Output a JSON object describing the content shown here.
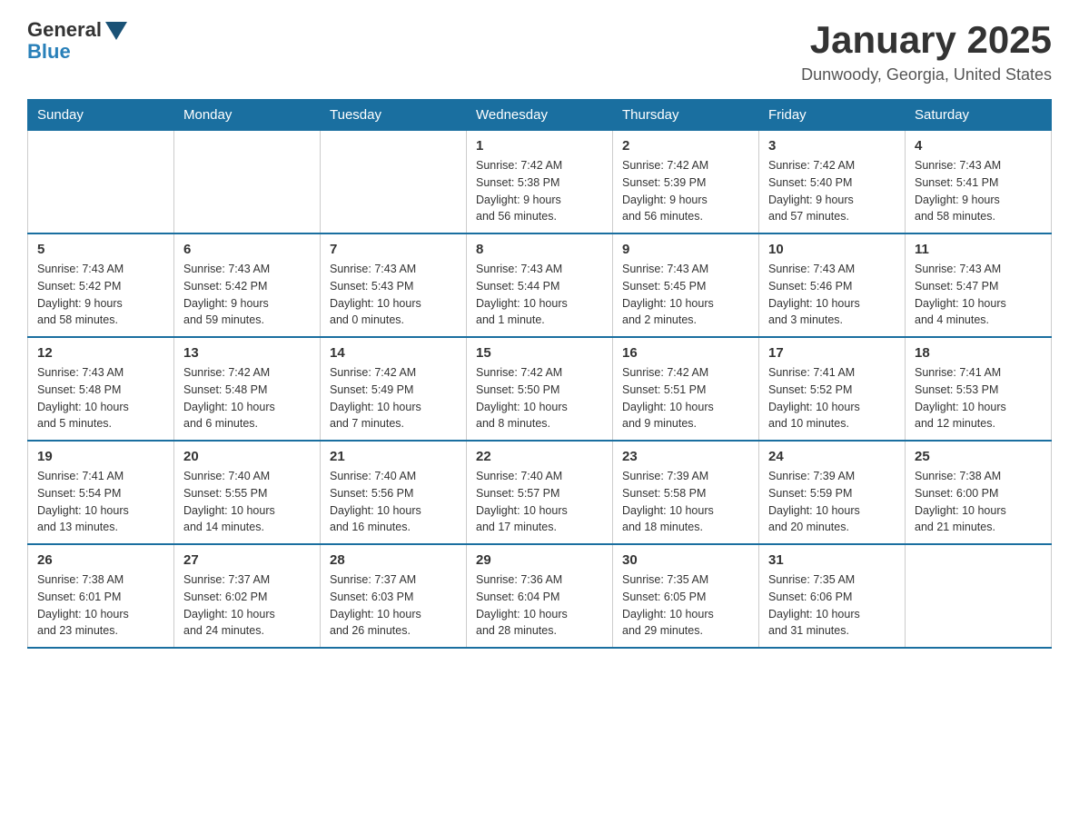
{
  "logo": {
    "general": "General",
    "blue": "Blue"
  },
  "header": {
    "title": "January 2025",
    "location": "Dunwoody, Georgia, United States"
  },
  "days_of_week": [
    "Sunday",
    "Monday",
    "Tuesday",
    "Wednesday",
    "Thursday",
    "Friday",
    "Saturday"
  ],
  "weeks": [
    [
      {
        "day": "",
        "info": ""
      },
      {
        "day": "",
        "info": ""
      },
      {
        "day": "",
        "info": ""
      },
      {
        "day": "1",
        "info": "Sunrise: 7:42 AM\nSunset: 5:38 PM\nDaylight: 9 hours\nand 56 minutes."
      },
      {
        "day": "2",
        "info": "Sunrise: 7:42 AM\nSunset: 5:39 PM\nDaylight: 9 hours\nand 56 minutes."
      },
      {
        "day": "3",
        "info": "Sunrise: 7:42 AM\nSunset: 5:40 PM\nDaylight: 9 hours\nand 57 minutes."
      },
      {
        "day": "4",
        "info": "Sunrise: 7:43 AM\nSunset: 5:41 PM\nDaylight: 9 hours\nand 58 minutes."
      }
    ],
    [
      {
        "day": "5",
        "info": "Sunrise: 7:43 AM\nSunset: 5:42 PM\nDaylight: 9 hours\nand 58 minutes."
      },
      {
        "day": "6",
        "info": "Sunrise: 7:43 AM\nSunset: 5:42 PM\nDaylight: 9 hours\nand 59 minutes."
      },
      {
        "day": "7",
        "info": "Sunrise: 7:43 AM\nSunset: 5:43 PM\nDaylight: 10 hours\nand 0 minutes."
      },
      {
        "day": "8",
        "info": "Sunrise: 7:43 AM\nSunset: 5:44 PM\nDaylight: 10 hours\nand 1 minute."
      },
      {
        "day": "9",
        "info": "Sunrise: 7:43 AM\nSunset: 5:45 PM\nDaylight: 10 hours\nand 2 minutes."
      },
      {
        "day": "10",
        "info": "Sunrise: 7:43 AM\nSunset: 5:46 PM\nDaylight: 10 hours\nand 3 minutes."
      },
      {
        "day": "11",
        "info": "Sunrise: 7:43 AM\nSunset: 5:47 PM\nDaylight: 10 hours\nand 4 minutes."
      }
    ],
    [
      {
        "day": "12",
        "info": "Sunrise: 7:43 AM\nSunset: 5:48 PM\nDaylight: 10 hours\nand 5 minutes."
      },
      {
        "day": "13",
        "info": "Sunrise: 7:42 AM\nSunset: 5:48 PM\nDaylight: 10 hours\nand 6 minutes."
      },
      {
        "day": "14",
        "info": "Sunrise: 7:42 AM\nSunset: 5:49 PM\nDaylight: 10 hours\nand 7 minutes."
      },
      {
        "day": "15",
        "info": "Sunrise: 7:42 AM\nSunset: 5:50 PM\nDaylight: 10 hours\nand 8 minutes."
      },
      {
        "day": "16",
        "info": "Sunrise: 7:42 AM\nSunset: 5:51 PM\nDaylight: 10 hours\nand 9 minutes."
      },
      {
        "day": "17",
        "info": "Sunrise: 7:41 AM\nSunset: 5:52 PM\nDaylight: 10 hours\nand 10 minutes."
      },
      {
        "day": "18",
        "info": "Sunrise: 7:41 AM\nSunset: 5:53 PM\nDaylight: 10 hours\nand 12 minutes."
      }
    ],
    [
      {
        "day": "19",
        "info": "Sunrise: 7:41 AM\nSunset: 5:54 PM\nDaylight: 10 hours\nand 13 minutes."
      },
      {
        "day": "20",
        "info": "Sunrise: 7:40 AM\nSunset: 5:55 PM\nDaylight: 10 hours\nand 14 minutes."
      },
      {
        "day": "21",
        "info": "Sunrise: 7:40 AM\nSunset: 5:56 PM\nDaylight: 10 hours\nand 16 minutes."
      },
      {
        "day": "22",
        "info": "Sunrise: 7:40 AM\nSunset: 5:57 PM\nDaylight: 10 hours\nand 17 minutes."
      },
      {
        "day": "23",
        "info": "Sunrise: 7:39 AM\nSunset: 5:58 PM\nDaylight: 10 hours\nand 18 minutes."
      },
      {
        "day": "24",
        "info": "Sunrise: 7:39 AM\nSunset: 5:59 PM\nDaylight: 10 hours\nand 20 minutes."
      },
      {
        "day": "25",
        "info": "Sunrise: 7:38 AM\nSunset: 6:00 PM\nDaylight: 10 hours\nand 21 minutes."
      }
    ],
    [
      {
        "day": "26",
        "info": "Sunrise: 7:38 AM\nSunset: 6:01 PM\nDaylight: 10 hours\nand 23 minutes."
      },
      {
        "day": "27",
        "info": "Sunrise: 7:37 AM\nSunset: 6:02 PM\nDaylight: 10 hours\nand 24 minutes."
      },
      {
        "day": "28",
        "info": "Sunrise: 7:37 AM\nSunset: 6:03 PM\nDaylight: 10 hours\nand 26 minutes."
      },
      {
        "day": "29",
        "info": "Sunrise: 7:36 AM\nSunset: 6:04 PM\nDaylight: 10 hours\nand 28 minutes."
      },
      {
        "day": "30",
        "info": "Sunrise: 7:35 AM\nSunset: 6:05 PM\nDaylight: 10 hours\nand 29 minutes."
      },
      {
        "day": "31",
        "info": "Sunrise: 7:35 AM\nSunset: 6:06 PM\nDaylight: 10 hours\nand 31 minutes."
      },
      {
        "day": "",
        "info": ""
      }
    ]
  ]
}
